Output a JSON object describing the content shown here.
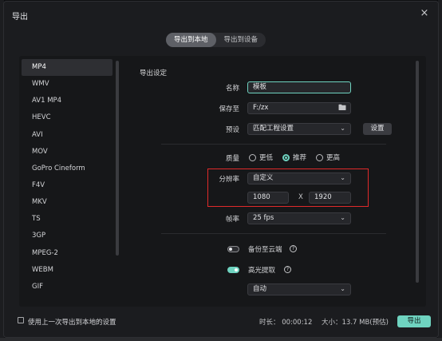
{
  "dialog": {
    "title": "导出",
    "close_icon": "×"
  },
  "tabs": [
    {
      "label": "导出到本地",
      "active": true
    },
    {
      "label": "导出到设备",
      "active": false
    }
  ],
  "formats": [
    "MP4",
    "WMV",
    "AV1 MP4",
    "HEVC",
    "AVI",
    "MOV",
    "GoPro Cineform",
    "F4V",
    "MKV",
    "TS",
    "3GP",
    "MPEG-2",
    "WEBM",
    "GIF"
  ],
  "selected_format": "MP4",
  "settings": {
    "section_title": "导出设定",
    "name_label": "名称",
    "name_value": "模板",
    "save_label": "保存至",
    "save_value": "F:/zx",
    "preset_label": "预设",
    "preset_value": "匹配工程设置",
    "preset_button": "设置",
    "quality_label": "质量",
    "quality_options": [
      {
        "label": "更低",
        "selected": false
      },
      {
        "label": "推荐",
        "selected": true
      },
      {
        "label": "更高",
        "selected": false
      }
    ],
    "resolution_label": "分辨率",
    "resolution_value": "自定义",
    "width": "1080",
    "height": "1920",
    "x_separator": "X",
    "fps_label": "帧率",
    "fps_value": "25 fps",
    "backup_label": "备份至云端",
    "backup_on": false,
    "highlight_label": "高光提取",
    "highlight_on": true,
    "highlight_mode": "自动",
    "help_glyph": "?"
  },
  "footer": {
    "checkbox_label": "使用上一次导出到本地的设置",
    "duration": "时长：  00:00:12",
    "size": "大小：13.7 MB(预估)",
    "export_button": "导出"
  },
  "colors": {
    "accent": "#6fd3c0",
    "highlight_box": "#e02a2a"
  }
}
